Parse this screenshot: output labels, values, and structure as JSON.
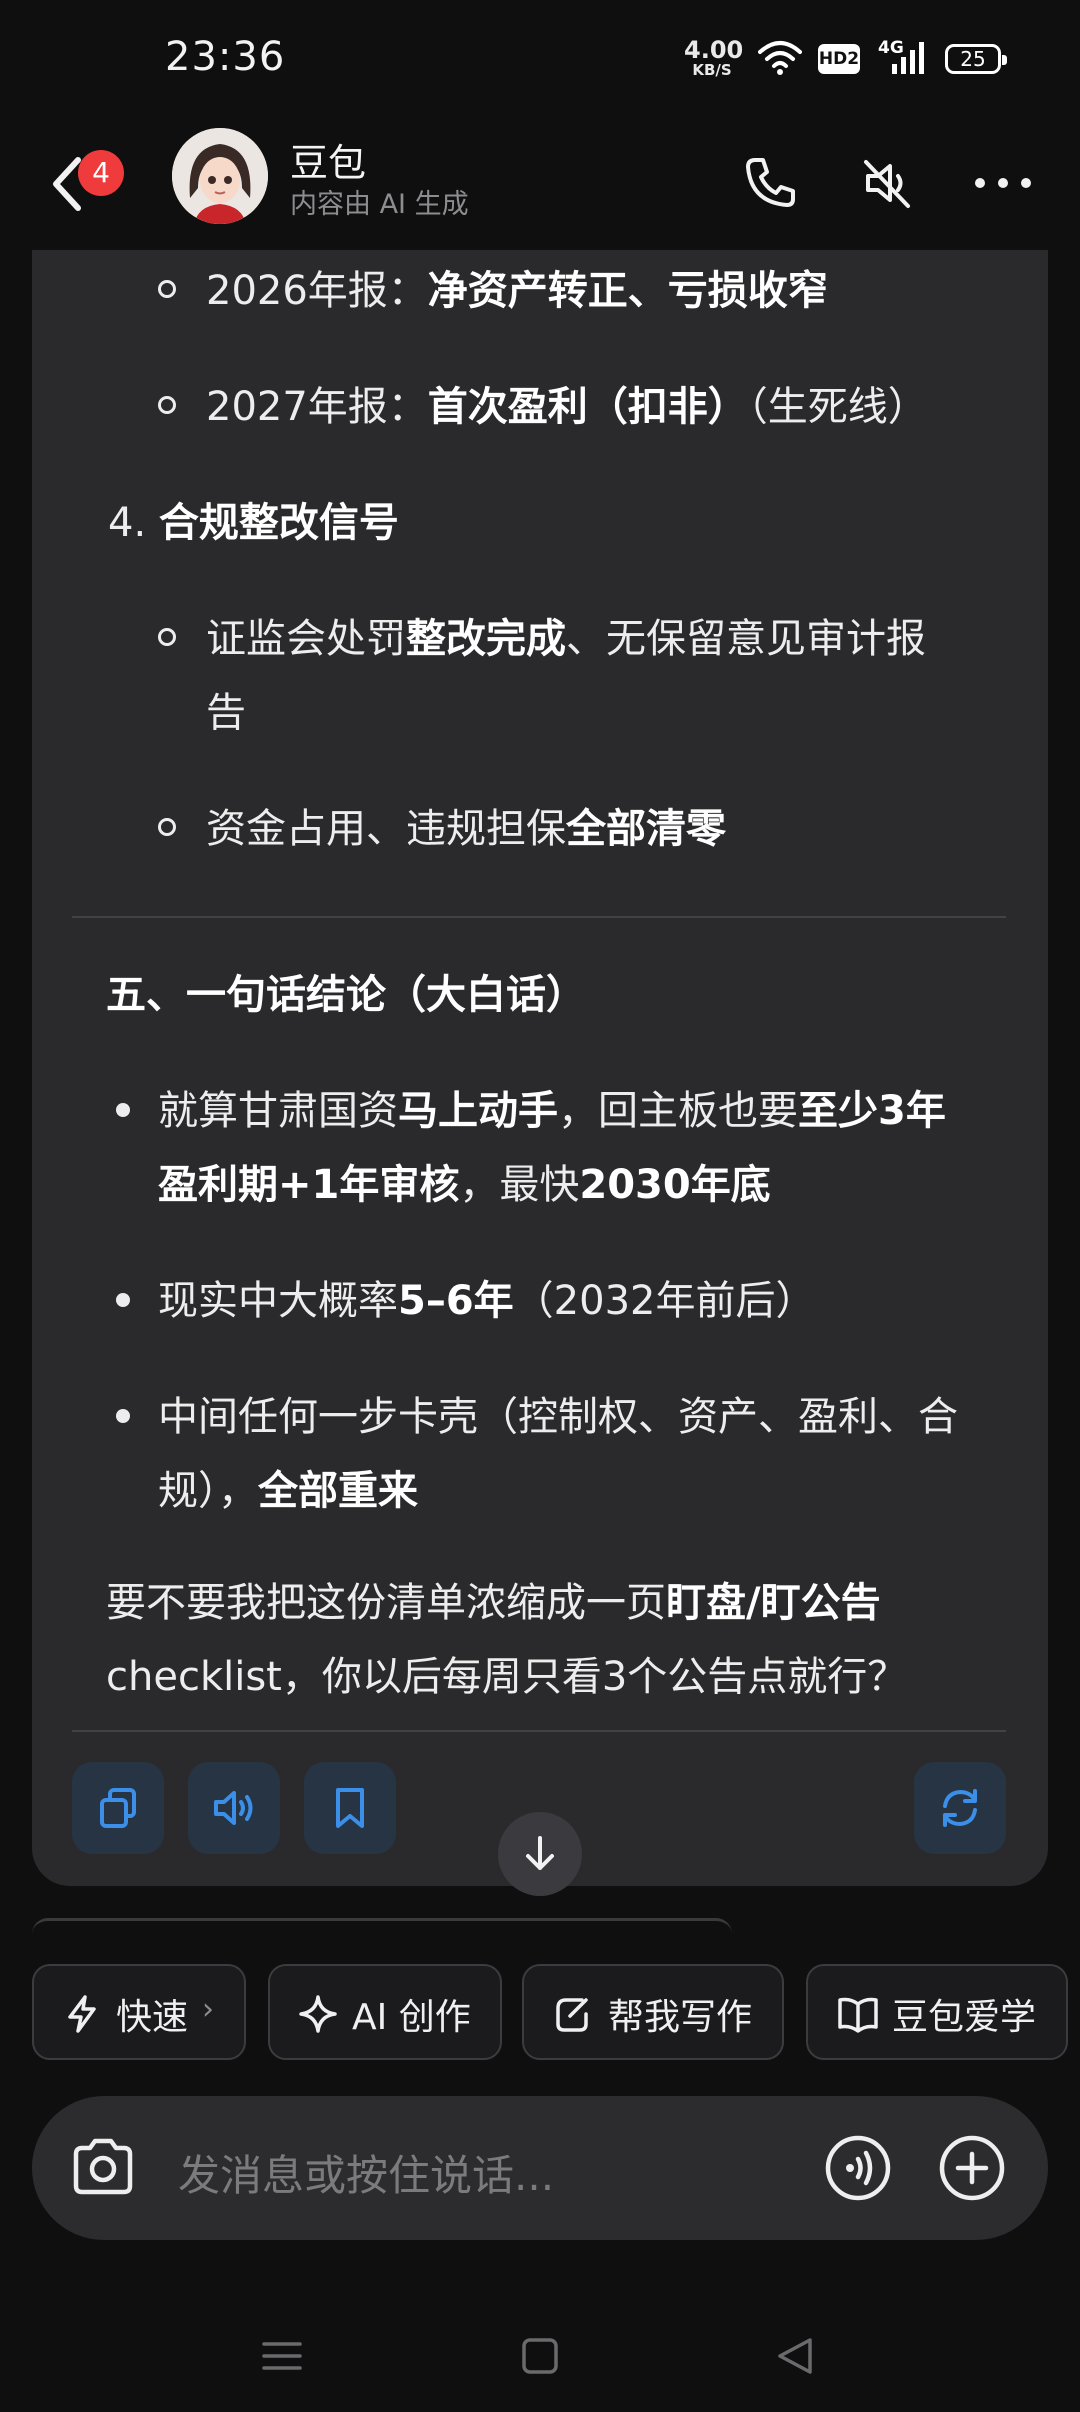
{
  "status_bar": {
    "time": "23:36",
    "net_speed": "4.00",
    "net_unit": "KB/S",
    "hd_label": "HD2",
    "signal_label": "4G",
    "battery": "25"
  },
  "header": {
    "back_badge": "4",
    "title": "豆包",
    "subtitle": "内容由 AI 生成"
  },
  "message": {
    "sub_items_top": [
      {
        "plain": "2026年报：",
        "bold": "净资产转正、亏损收窄",
        "tail": ""
      },
      {
        "plain": "2027年报：",
        "bold": "首次盈利（扣非）",
        "tail": "（生死线）"
      }
    ],
    "section4_number": "4.",
    "section4_title": "合规整改信号",
    "section4_items": [
      {
        "l1_plain": "证监会处罚",
        "l1_bold": "整改完成",
        "l1_tail": "、无保留意见审计报",
        "l2": "告"
      },
      {
        "plain": "资金占用、违规担保",
        "bold": "全部清零"
      }
    ],
    "section5_title": "五、一句话结论（大白话）",
    "bullets": [
      {
        "l1_a": "就算甘肃国资",
        "l1_b": "马上动手",
        "l1_c": "，回主板也要",
        "l1_d": "至少3年",
        "l2_a": "盈利期+1年审核",
        "l2_b": "，最快",
        "l2_c": "2030年底"
      },
      {
        "a": "现实中大概率",
        "b": "5–6年",
        "c": "（2032年前后）"
      },
      {
        "l1": "中间任何一步卡壳（控制权、资产、盈利、合",
        "l2_a": "规），",
        "l2_b": "全部重来"
      }
    ],
    "closing_l1_a": "要不要我把这份清单浓缩成一页",
    "closing_l1_b": "盯盘/盯公告",
    "closing_l2": "checklist，你以后每周只看3个公告点就行？"
  },
  "quick_chips": [
    {
      "label": "快速",
      "suffix": "›"
    },
    {
      "label": "AI 创作"
    },
    {
      "label": "帮我写作"
    },
    {
      "label": "豆包爱学"
    }
  ],
  "input": {
    "placeholder": "发消息或按住说话..."
  },
  "colors": {
    "accent_blue": "#3b8fe8",
    "card_bg": "#2a2a2c",
    "badge_red": "#ef3b3b"
  }
}
